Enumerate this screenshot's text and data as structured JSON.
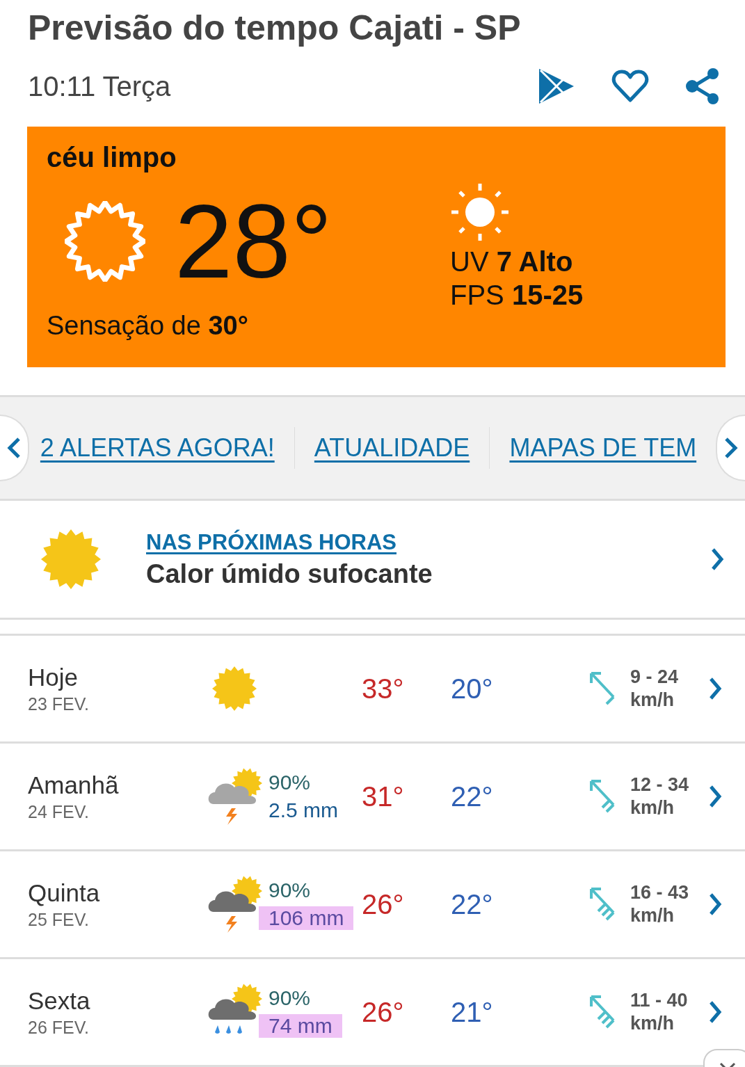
{
  "header": {
    "title": "Previsão do tempo Cajati - SP",
    "time": "10:11 Terça"
  },
  "current": {
    "condition": "céu limpo",
    "temperature": "28°",
    "feels_like_label": "Sensação de",
    "feels_like": "30°",
    "uv_label": "UV",
    "uv_value": "7 Alto",
    "fps_label": "FPS",
    "fps_value": "15-25"
  },
  "tabs": [
    {
      "label": "2 ALERTAS AGORA!"
    },
    {
      "label": "ATUALIDADE"
    },
    {
      "label": "MAPAS DE TEM"
    }
  ],
  "next_hours": {
    "link": "NAS PRÓXIMAS HORAS",
    "summary": "Calor úmido sufocante"
  },
  "days": [
    {
      "day": "Hoje",
      "date": "23 FEV.",
      "kind": "sun",
      "max": "33°",
      "min": "20°",
      "wind": {
        "kind": "light",
        "speed": "9 - 24",
        "unit": "km/h"
      }
    },
    {
      "day": "Amanhã",
      "date": "24 FEV.",
      "kind": "storm-light",
      "rain_chance": "90%",
      "rain_amount": "2.5 mm",
      "highlighted": false,
      "max": "31°",
      "min": "22°",
      "wind": {
        "kind": "moderate",
        "speed": "12 - 34",
        "unit": "km/h"
      }
    },
    {
      "day": "Quinta",
      "date": "25 FEV.",
      "kind": "storm",
      "rain_chance": "90%",
      "rain_amount": "106 mm",
      "highlighted": true,
      "max": "26°",
      "min": "22°",
      "wind": {
        "kind": "strong",
        "speed": "16 - 43",
        "unit": "km/h"
      }
    },
    {
      "day": "Sexta",
      "date": "26 FEV.",
      "kind": "rain",
      "rain_chance": "90%",
      "rain_amount": "74 mm",
      "highlighted": true,
      "max": "26°",
      "min": "21°",
      "wind": {
        "kind": "strong",
        "speed": "11 - 40",
        "unit": "km/h"
      }
    }
  ]
}
